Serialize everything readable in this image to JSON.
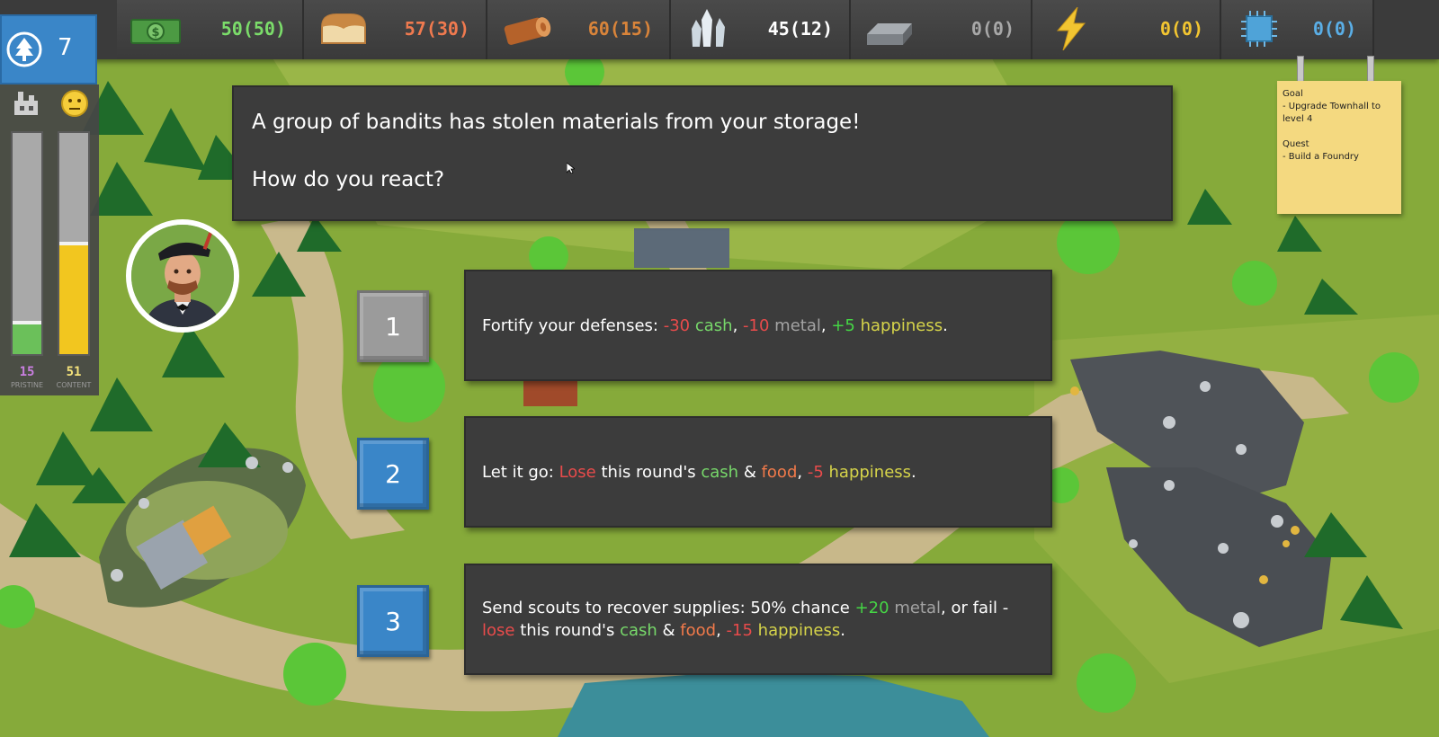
{
  "resources": [
    {
      "name": "cash",
      "icon": "cash-icon",
      "value": "50(50)",
      "color": "#7bdc6a"
    },
    {
      "name": "food",
      "icon": "bread-icon",
      "value": "57(30)",
      "color": "#f07a4f"
    },
    {
      "name": "wood",
      "icon": "log-icon",
      "value": "60(15)",
      "color": "#d9843a"
    },
    {
      "name": "crystal",
      "icon": "crystal-icon",
      "value": "45(12)",
      "color": "#ffffff"
    },
    {
      "name": "metal",
      "icon": "metal-ingot-icon",
      "value": "0(0)",
      "color": "#a8a8a8"
    },
    {
      "name": "energy",
      "icon": "lightning-icon",
      "value": "0(0)",
      "color": "#f2c531"
    },
    {
      "name": "tech",
      "icon": "chip-icon",
      "value": "0(0)",
      "color": "#5aaee6"
    }
  ],
  "turn": {
    "icon": "globe-tree-icon",
    "value": "7"
  },
  "meters": {
    "pristine": {
      "icon": "factory-icon",
      "value": "15",
      "label": "PRISTINE",
      "level": 0.15,
      "color": "#6bc05a",
      "text_color": "#c97fe0"
    },
    "content": {
      "icon": "neutral-face-icon",
      "value": "51",
      "label": "CONTENT",
      "level": 0.51,
      "color": "#f2c61f",
      "text_color": "#f4e27a"
    }
  },
  "advisor": {
    "icon": "advisor-portrait"
  },
  "event": {
    "line1": "A group of bandits has stolen materials from your storage!",
    "line2": "How do you react?"
  },
  "choices": [
    {
      "number": "1",
      "style": "gray",
      "parts": [
        {
          "text": "Fortify your defenses: ",
          "cls": ""
        },
        {
          "text": "-30",
          "cls": "t-neg"
        },
        {
          "text": " ",
          "cls": ""
        },
        {
          "text": "cash",
          "cls": "t-cash"
        },
        {
          "text": ", ",
          "cls": ""
        },
        {
          "text": "-10",
          "cls": "t-neg"
        },
        {
          "text": " ",
          "cls": ""
        },
        {
          "text": "metal",
          "cls": "t-metal"
        },
        {
          "text": ", ",
          "cls": ""
        },
        {
          "text": "+5",
          "cls": "t-pos"
        },
        {
          "text": " ",
          "cls": ""
        },
        {
          "text": "happiness",
          "cls": "t-happy"
        },
        {
          "text": ".",
          "cls": ""
        }
      ]
    },
    {
      "number": "2",
      "style": "blue",
      "parts": [
        {
          "text": "Let it go: ",
          "cls": ""
        },
        {
          "text": "Lose",
          "cls": "t-neg"
        },
        {
          "text": " this round's ",
          "cls": ""
        },
        {
          "text": "cash",
          "cls": "t-cash"
        },
        {
          "text": " & ",
          "cls": ""
        },
        {
          "text": "food",
          "cls": "t-food"
        },
        {
          "text": ", ",
          "cls": ""
        },
        {
          "text": "-5",
          "cls": "t-neg"
        },
        {
          "text": " ",
          "cls": ""
        },
        {
          "text": "happiness",
          "cls": "t-happy"
        },
        {
          "text": ".",
          "cls": ""
        }
      ]
    },
    {
      "number": "3",
      "style": "blue",
      "parts": [
        {
          "text": "Send scouts to recover supplies: 50% chance ",
          "cls": ""
        },
        {
          "text": "+20",
          "cls": "t-pos"
        },
        {
          "text": " ",
          "cls": ""
        },
        {
          "text": "metal",
          "cls": "t-metal"
        },
        {
          "text": ", or fail - ",
          "cls": ""
        },
        {
          "text": "lose",
          "cls": "t-neg"
        },
        {
          "text": " this round's ",
          "cls": ""
        },
        {
          "text": "cash",
          "cls": "t-cash"
        },
        {
          "text": " & ",
          "cls": ""
        },
        {
          "text": "food",
          "cls": "t-food"
        },
        {
          "text": ", ",
          "cls": ""
        },
        {
          "text": "-15",
          "cls": "t-neg"
        },
        {
          "text": " ",
          "cls": ""
        },
        {
          "text": "happiness",
          "cls": "t-happy"
        },
        {
          "text": ".",
          "cls": ""
        }
      ]
    }
  ],
  "note": {
    "goal_title": "Goal",
    "goal_item": "- Upgrade Townhall to level 4",
    "quest_title": "Quest",
    "quest_item": "- Build a Foundry"
  }
}
